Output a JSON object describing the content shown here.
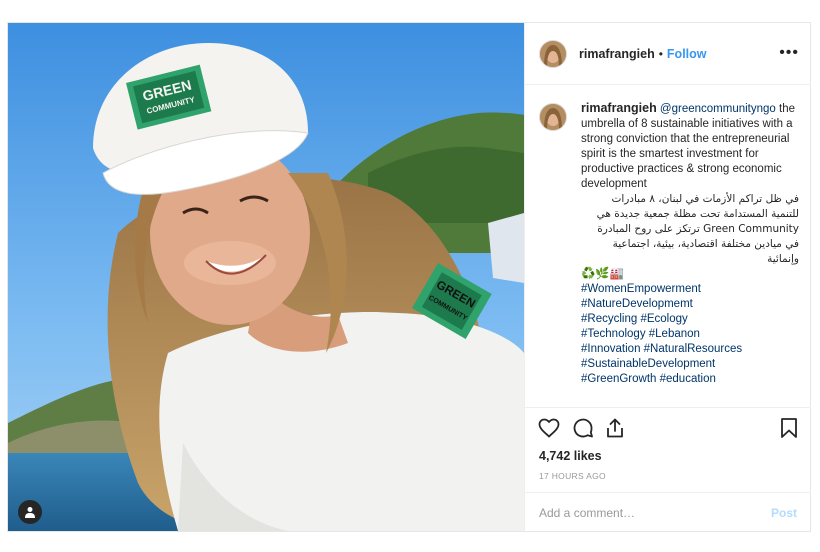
{
  "post": {
    "username": "rimafrangieh",
    "separator": "•",
    "follow_label": "Follow",
    "more_label": "•••",
    "caption_mention": "@greencommunityngo",
    "caption_en": "the umbrella of 8 sustainable initiatives with a strong conviction that the entrepreneurial spirit is the smartest investment for productive practices & strong economic development",
    "caption_ar": "في ظل تراكم الأزمات في لبنان، ٨ مبادرات للتنمية المستدامة تحت مظلة جمعية جديدة هي Green Community ترتكز على روح المبادرة في ميادين مختلفة اقتصادية، بيئية، اجتماعية وإنمائية",
    "caption_emoji": "♻️🌿🏭",
    "hashtags": [
      "#WomenEmpowerment",
      "#NatureDevelopmemt",
      "#Recycling #Ecology",
      "#Technology #Lebanon",
      "#Innovation #NaturalResources",
      "#SustainableDevelopment",
      "#GreenGrowth #education"
    ],
    "likes": "4,742 likes",
    "timestamp": "17 HOURS AGO",
    "comment_placeholder": "Add a comment…",
    "post_label": "Post"
  },
  "photo": {
    "cap_logo_text_1": "GREEN",
    "cap_logo_text_2": "COMMUNITY",
    "shirt_logo_text_1": "GREEN",
    "shirt_logo_text_2": "COMMUNITY"
  },
  "icons": {
    "like": "heart-icon",
    "comment": "comment-icon",
    "share": "share-icon",
    "save": "bookmark-icon",
    "user_tag": "user-icon",
    "more": "ellipsis-icon"
  },
  "colors": {
    "link": "#3897f0",
    "hashtag": "#003569",
    "muted": "#999999",
    "border": "#efefef"
  }
}
